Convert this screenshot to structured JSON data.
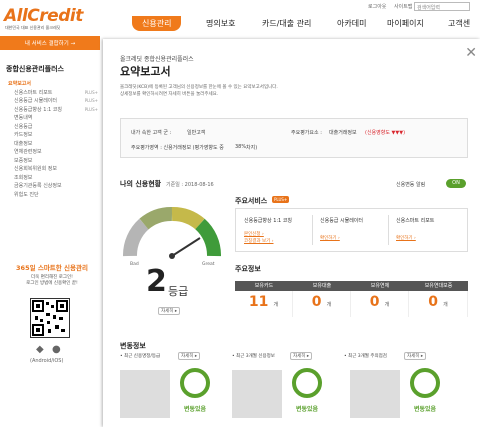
{
  "util": {
    "logout": "로그아웃",
    "sitemap": "사이트맵",
    "search_placeholder": "검색어입력"
  },
  "logo": {
    "name": "AllCredit",
    "tagline": "대한민국 대표 신용관리 올크레딧"
  },
  "gnb": [
    "신용관리",
    "명의보호",
    "카드/대출 관리",
    "아카데미",
    "마이페이지",
    "고객센"
  ],
  "sidebar": {
    "top_label": "내 서비스 결합하기 →",
    "title": "종합신용관리플러스",
    "items": [
      {
        "label": "요약보고서",
        "plus": ""
      },
      {
        "label": "신용스마트 리포트",
        "plus": "PLUS+"
      },
      {
        "label": "신용등급 시뮬레이터",
        "plus": "PLUS+"
      },
      {
        "label": "신용등급향상 1:1 코칭",
        "plus": "PLUS+"
      },
      {
        "label": "변동내역",
        "plus": ""
      },
      {
        "label": "신용등급",
        "plus": ""
      },
      {
        "label": "카드정보",
        "plus": ""
      },
      {
        "label": "대출정보",
        "plus": ""
      },
      {
        "label": "연체관련정보",
        "plus": ""
      },
      {
        "label": "보증정보",
        "plus": ""
      },
      {
        "label": "신용회복위원회 정보",
        "plus": ""
      },
      {
        "label": "조회정보",
        "plus": ""
      },
      {
        "label": "금융기관등록 신상정보",
        "plus": ""
      },
      {
        "label": "위험도 진단",
        "plus": ""
      }
    ],
    "promo_title": "365일 스마트한 신용관리",
    "promo_line1": "더욱 편리해진 로그인!",
    "promo_line2": "로그인 방법에 신용확인 끝!",
    "app_label": "(Android/iOS)"
  },
  "modal": {
    "subtitle": "올크레딧 종합신용관리플러스",
    "title": "요약보고서",
    "desc1": "올크레딧(KCB)에 등록된 고객님의 신용정보를 한눈에 볼 수 있는 요약보고서입니다.",
    "desc2": "상세정보를 확인하시려면 자세히 버튼을 눌러주세요.",
    "info": {
      "nice_label": "내가 속한 고객 군 :",
      "nice_value": "일반고객",
      "main_label": "주요평가요소 :",
      "main_value": "대출거래정보",
      "main_suffix": "(신용영향도 ▼▼▼)",
      "area_label": "주요평가영역 : 신용거래정보 (평가영향도 중",
      "area_pct": "38%",
      "area_suffix": "차지)"
    }
  },
  "credit": {
    "section_title": "나의 신용현황",
    "date_label": "기준일 : 2018-08-16",
    "grade_num": "2",
    "grade_unit": "등급",
    "bad": "Bad",
    "great": "Great",
    "detail": "자세히 ▸",
    "alert_label": "신용변동 알림",
    "toggle": "ON"
  },
  "services": {
    "title": "주요서비스",
    "badge": "PLUS+",
    "cards": [
      {
        "label": "신용등급향상 1:1 코칭",
        "links": [
          "본인신청 ›",
          "코칭결과 보기 ›"
        ]
      },
      {
        "label": "신용등급 시뮬레이터",
        "links": [
          "확인하기 ›"
        ]
      },
      {
        "label": "신용스마트 리포트",
        "links": [
          "확인하기 ›"
        ]
      }
    ]
  },
  "main_info": {
    "title": "주요정보",
    "columns": [
      {
        "label": "보유카드",
        "value": "11",
        "unit": "개"
      },
      {
        "label": "보유대출",
        "value": "0",
        "unit": "개"
      },
      {
        "label": "보유연체",
        "value": "0",
        "unit": "개"
      },
      {
        "label": "보유연대보증",
        "value": "0",
        "unit": "개"
      }
    ]
  },
  "changes": {
    "title": "변동정보",
    "items": [
      {
        "label": "최근 신용명정/등급",
        "detail": "자세히 ▸",
        "status": "변동있음"
      },
      {
        "label": "최근 3개월 신용정보",
        "detail": "자세히 ▸",
        "status": "변동있음"
      },
      {
        "label": "최근 3개월 주의점검",
        "detail": "자세히 ▸",
        "status": "변동있음"
      }
    ]
  },
  "colors": {
    "accent": "#f07a1b",
    "green": "#5aa02c",
    "red": "#d9282f"
  }
}
